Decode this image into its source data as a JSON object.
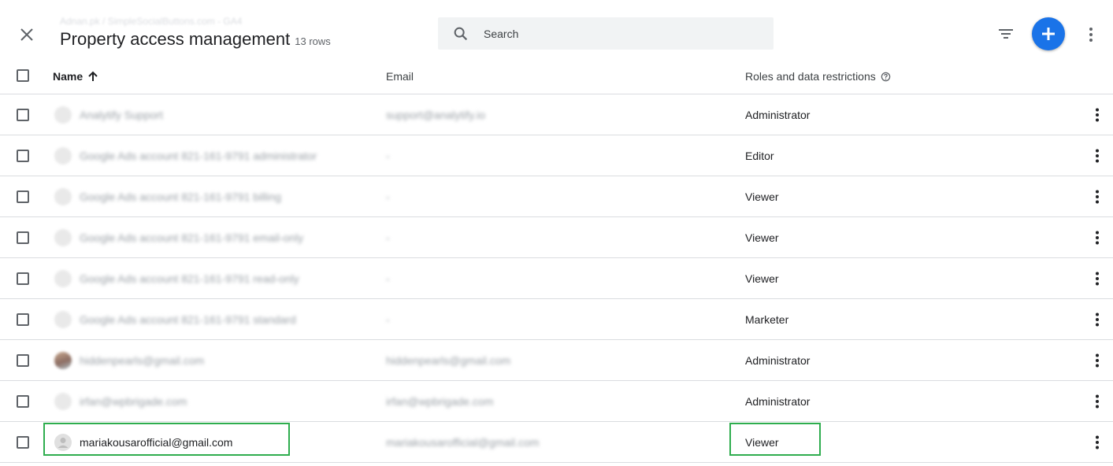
{
  "header": {
    "breadcrumb": "Adnan.pk / SimpleSocialButtons.com - GA4",
    "title": "Property access management",
    "rows_count": "13 rows",
    "search_placeholder": "Search",
    "accent_color": "#1a73e8"
  },
  "table": {
    "columns": {
      "name": "Name",
      "email": "Email",
      "roles": "Roles and data restrictions"
    },
    "sort": "name ascending",
    "rows": [
      {
        "name": "Analytify Support",
        "email": "support@analytify.io",
        "role": "Administrator",
        "avatar": "default",
        "blurred": true
      },
      {
        "name": "Google Ads account 821-161-9791 administrator",
        "email": "-",
        "role": "Editor",
        "avatar": "default",
        "blurred": true
      },
      {
        "name": "Google Ads account 821-161-9791 billing",
        "email": "-",
        "role": "Viewer",
        "avatar": "default",
        "blurred": true
      },
      {
        "name": "Google Ads account 821-161-9791 email-only",
        "email": "-",
        "role": "Viewer",
        "avatar": "default",
        "blurred": true
      },
      {
        "name": "Google Ads account 821-161-9791 read-only",
        "email": "-",
        "role": "Viewer",
        "avatar": "default",
        "blurred": true
      },
      {
        "name": "Google Ads account 821-161-9791 standard",
        "email": "-",
        "role": "Marketer",
        "avatar": "default",
        "blurred": true
      },
      {
        "name": "hiddenpearls@gmail.com",
        "email": "hiddenpearls@gmail.com",
        "role": "Administrator",
        "avatar": "photo",
        "blurred": true
      },
      {
        "name": "irfan@wpbrigade.com",
        "email": "irfan@wpbrigade.com",
        "role": "Administrator",
        "avatar": "default",
        "blurred": true
      },
      {
        "name": "mariakousarofficial@gmail.com",
        "email": "mariakousarofficial@gmail.com",
        "role": "Viewer",
        "avatar": "default",
        "blurred": false,
        "email_blurred": true,
        "highlighted": true
      }
    ]
  },
  "highlight_color": "#2ead4e"
}
